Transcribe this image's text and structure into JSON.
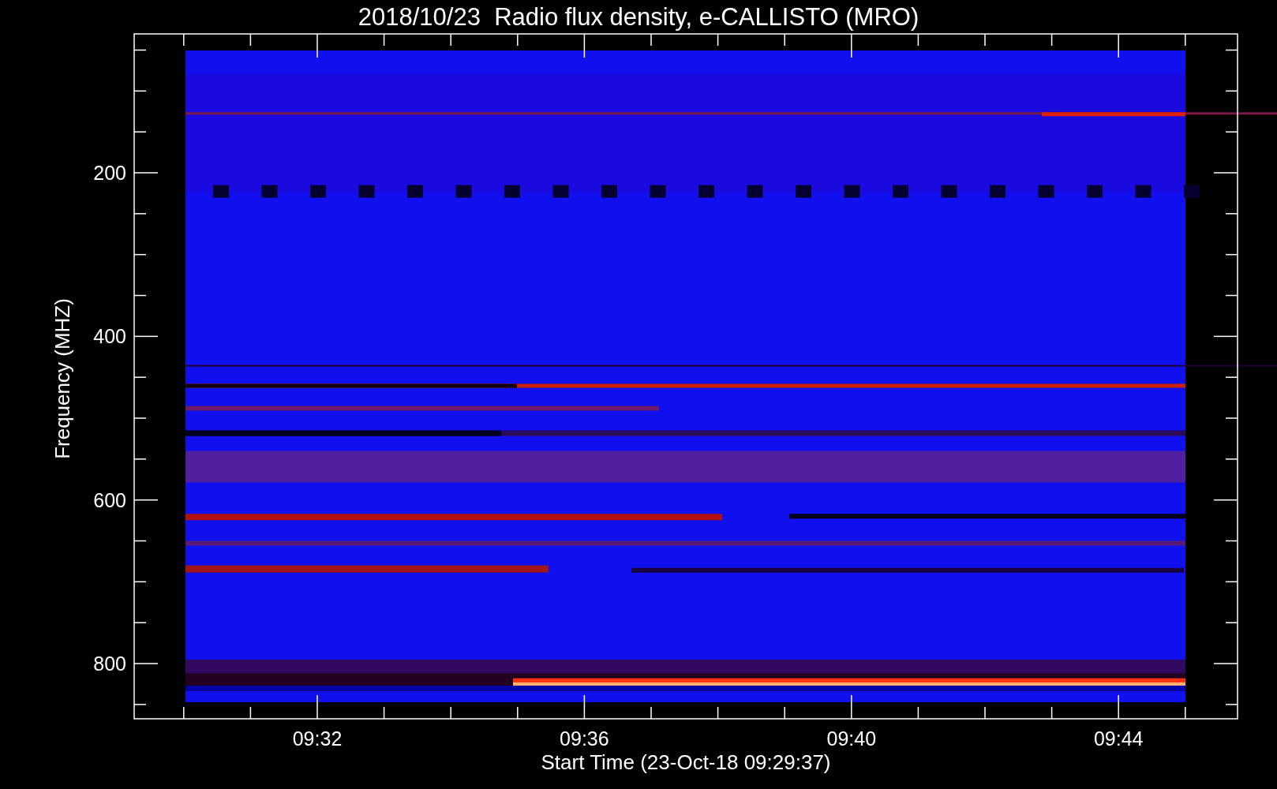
{
  "title": "2018/10/23  Radio flux density, e-CALLISTO (MRO)",
  "plot": {
    "ylabel": "Frequency (MHZ)",
    "xlabel": "Start Time (23-Oct-18 09:29:37)",
    "yticks": [
      "200",
      "400",
      "600",
      "800"
    ],
    "xticks": [
      "09:32",
      "09:36",
      "09:40",
      "09:44"
    ]
  }
}
